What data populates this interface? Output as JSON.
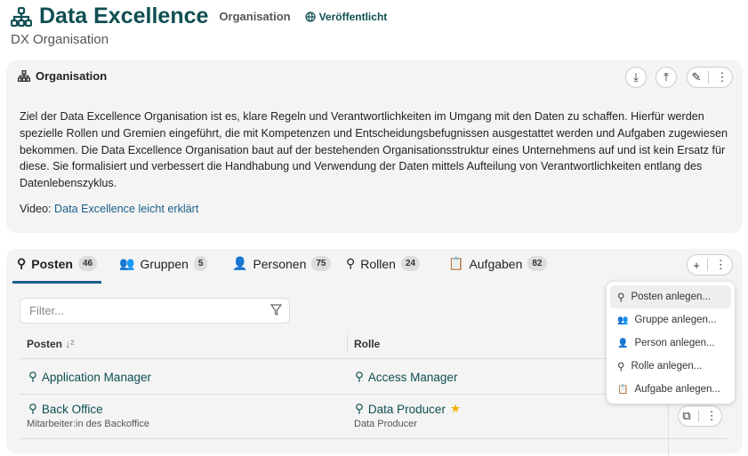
{
  "header": {
    "title": "Data Excellence",
    "type": "Organisation",
    "status": "Veröffentlicht",
    "subtitle": "DX Organisation"
  },
  "org_card": {
    "title": "Organisation",
    "description": "Ziel der Data Excellence Organisation ist es, klare Regeln und Verantwortlichkeiten im Umgang mit den Daten zu schaffen. Hierfür werden spezielle Rollen und Gremien eingeführt, die mit Kompetenzen und Entscheidungsbefugnissen ausgestattet werden und Aufgaben zugewiesen bekommen. Die Data Excellence Organisation baut auf der bestehenden Organisationsstruktur eines Unternehmens auf und ist kein Ersatz für diese. Sie formalisiert und verbessert die Handhabung und Verwendung der Daten mittels Aufteilung von Verantwortlichkeiten entlang des Datenlebenszyklus.",
    "video_label": "Video:",
    "video_link": "Data Excellence leicht erklärt"
  },
  "tabs": [
    {
      "label": "Posten",
      "count": "46"
    },
    {
      "label": "Gruppen",
      "count": "5"
    },
    {
      "label": "Personen",
      "count": "75"
    },
    {
      "label": "Rollen",
      "count": "24"
    },
    {
      "label": "Aufgaben",
      "count": "82"
    }
  ],
  "filter": {
    "placeholder": "Filter..."
  },
  "table": {
    "headers": [
      "Posten",
      "Rolle"
    ],
    "rows": [
      {
        "posten": "Application Manager",
        "posten_desc": "",
        "rolle": "Access Manager",
        "rolle_desc": ""
      },
      {
        "posten": "Back Office",
        "posten_desc": "Mitarbeiter:in des Backoffice",
        "rolle": "Data Producer",
        "rolle_desc": "Data Producer"
      }
    ]
  },
  "menu": [
    "Posten anlegen...",
    "Gruppe anlegen...",
    "Person anlegen...",
    "Rolle anlegen...",
    "Aufgabe anlegen..."
  ]
}
